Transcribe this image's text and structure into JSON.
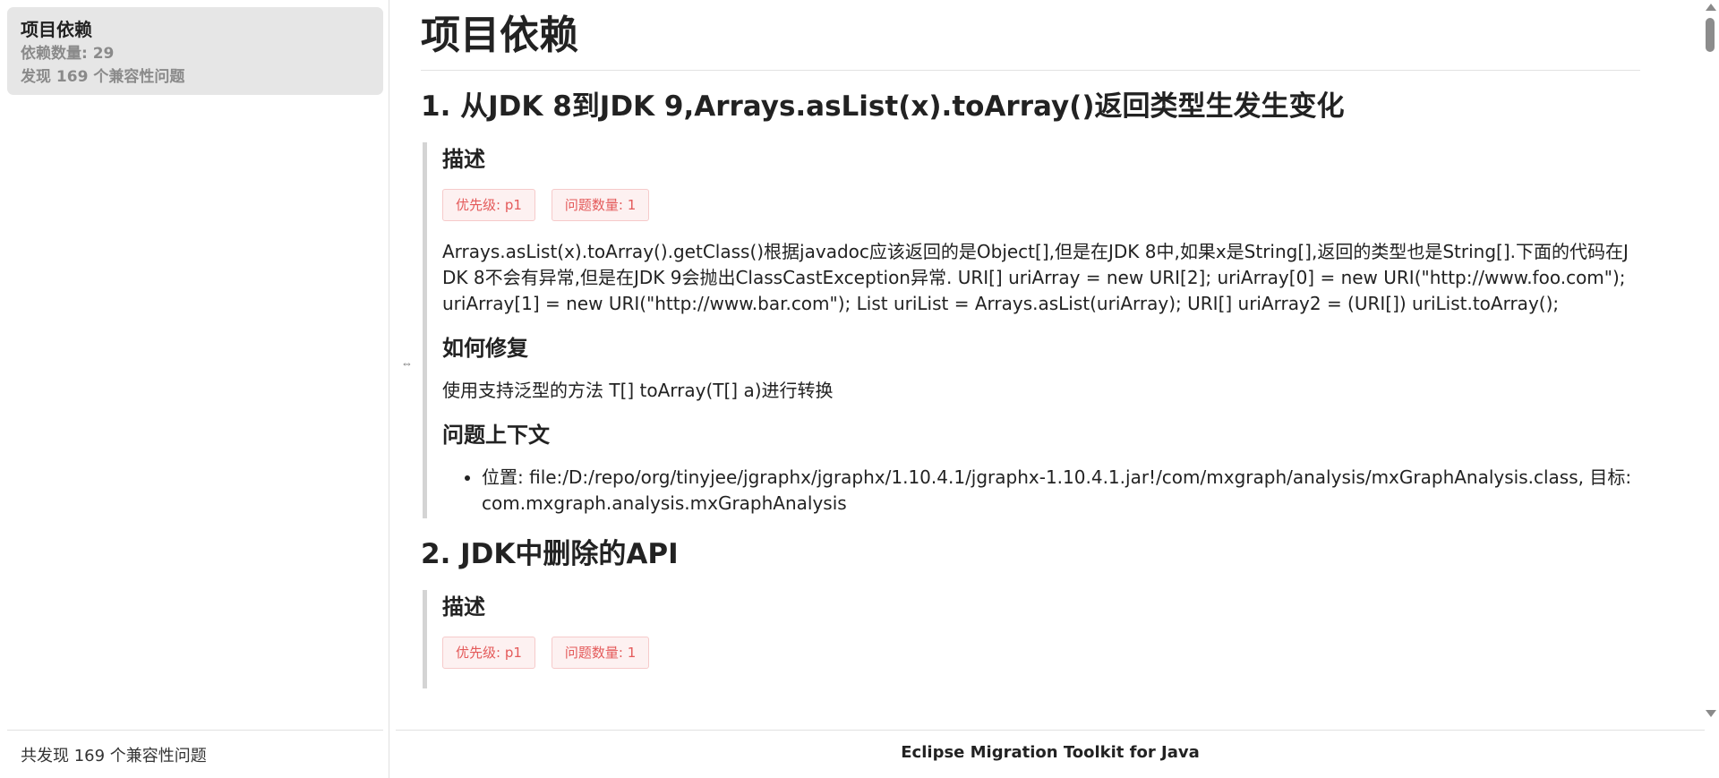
{
  "sidebar": {
    "card": {
      "title": "项目依赖",
      "dependency_count": "依赖数量: 29",
      "issues_found": "发现 169 个兼容性问题"
    },
    "footer": "共发现 169 个兼容性问题"
  },
  "main": {
    "page_title": "项目依赖",
    "issues": [
      {
        "title": "1. 从JDK 8到JDK 9,Arrays.asList(x).toArray()返回类型生发生变化",
        "description_heading": "描述",
        "badges": [
          "优先级: p1",
          "问题数量: 1"
        ],
        "description": "Arrays.asList(x).toArray().getClass()根据javadoc应该返回的是Object[],但是在JDK 8中,如果x是String[],返回的类型也是String[].下面的代码在JDK 8不会有异常,但是在JDK 9会抛出ClassCastException异常. URI[] uriArray = new URI[2]; uriArray[0] = new URI(\"http://www.foo.com\"); uriArray[1] = new URI(\"http://www.bar.com\"); List uriList = Arrays.asList(uriArray); URI[] uriArray2 = (URI[]) uriList.toArray();",
        "fix_heading": "如何修复",
        "fix": "使用支持泛型的方法 T[] toArray(T[] a)进行转换",
        "context_heading": "问题上下文",
        "context": [
          "位置: file:/D:/repo/org/tinyjee/jgraphx/jgraphx/1.10.4.1/jgraphx-1.10.4.1.jar!/com/mxgraph/analysis/mxGraphAnalysis.class, 目标: com.mxgraph.analysis.mxGraphAnalysis"
        ]
      },
      {
        "title": "2. JDK中删除的API",
        "description_heading": "描述",
        "badges": [
          "优先级: p1",
          "问题数量: 1"
        ]
      }
    ]
  },
  "footer": {
    "app_name": "Eclipse Migration Toolkit for Java"
  },
  "icons": {
    "resize_handle": "⇔"
  },
  "colors": {
    "badge_text": "#e45a5a",
    "badge_bg": "#fdf1f1",
    "card_bg": "#e6e6e6"
  }
}
